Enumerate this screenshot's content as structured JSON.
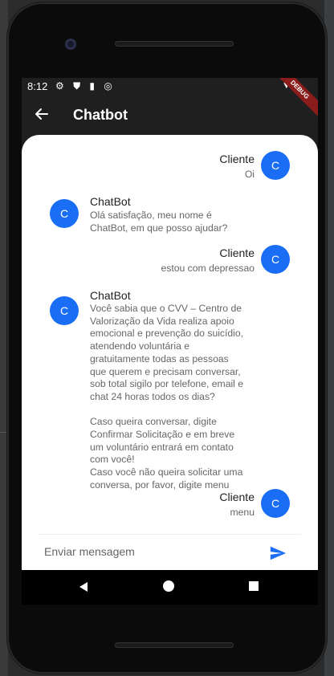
{
  "status": {
    "time": "8:12",
    "debug": "DEBUG"
  },
  "appbar": {
    "title": "Chatbot"
  },
  "messages": [
    {
      "side": "right",
      "sender": "Cliente",
      "text": "Oi",
      "avatar": "C"
    },
    {
      "side": "left",
      "sender": "ChatBot",
      "text": "Olá satisfação, meu nome é\nChatBot, em que posso ajudar?",
      "avatar": "C"
    },
    {
      "side": "right",
      "sender": "Cliente",
      "text": "estou com depressao",
      "avatar": "C"
    },
    {
      "side": "left",
      "sender": "ChatBot",
      "text": "Você sabia que o CVV – Centro de\nValorização da Vida realiza apoio\nemocional e prevenção do suicídio,\natendendo voluntária e\ngratuitamente todas as pessoas\nque querem e precisam conversar,\nsob total sigilo por telefone, email e\nchat 24 horas todos os dias?\n\nCaso queira conversar, digite\nConfirmar Solicitação e em breve\num voluntário entrará em contato\ncom você!\nCaso você não queira solicitar uma\nconversa, por favor, digite menu",
      "avatar": "C"
    },
    {
      "side": "right",
      "sender": "Cliente",
      "text": "menu",
      "avatar": "C"
    }
  ],
  "composer": {
    "placeholder": "Enviar mensagem"
  },
  "colors": {
    "accent": "#1a6ef5"
  },
  "icons": {
    "back": "arrow-left-icon",
    "send": "send-icon",
    "nav_back": "triangle-back-icon",
    "nav_home": "circle-home-icon",
    "nav_recent": "square-recent-icon"
  }
}
